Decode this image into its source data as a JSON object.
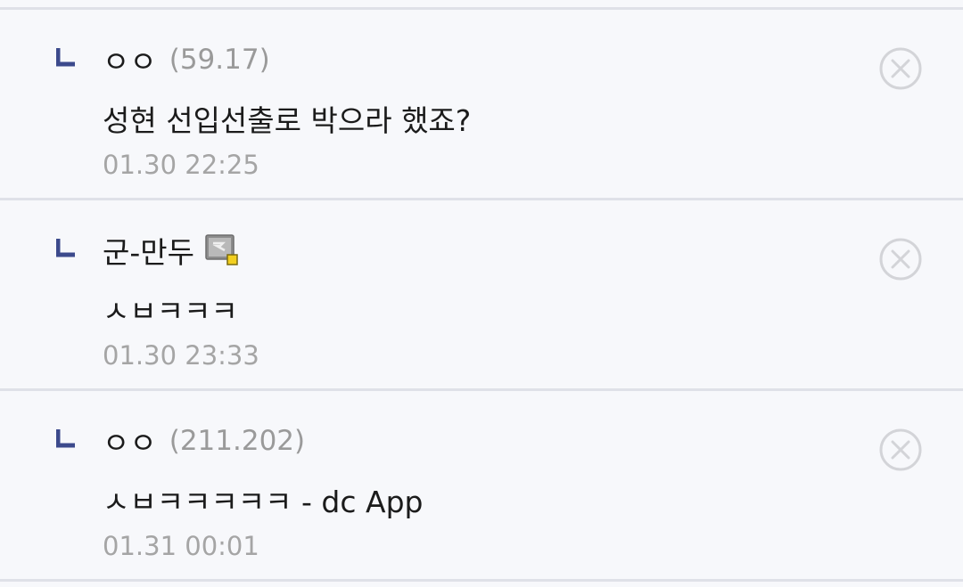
{
  "colors": {
    "background": "#f7f8fb",
    "divider": "#dfe1e8",
    "reply_mark": "#3c4a8c",
    "text": "#1b1b1b",
    "meta": "#a5a5a5",
    "delete_icon": "#d3d4d8"
  },
  "icons": {
    "reply": "reply-arrow-icon",
    "delete": "close-circle-icon",
    "badge": "fixed-nickname-badge-icon"
  },
  "comments": [
    {
      "nick": "ㅇㅇ",
      "ip": "(59.17)",
      "text": "성현 선입선출로 박으라 했죠?",
      "time": "01.30 22:25"
    },
    {
      "nick": "군-만두",
      "ip": "",
      "text": "ㅅㅂㅋㅋㅋ",
      "time": "01.30 23:33"
    },
    {
      "nick": "ㅇㅇ",
      "ip": "(211.202)",
      "text": "ㅅㅂㅋㅋㅋㅋㅋ - dc App",
      "time": "01.31 00:01"
    }
  ]
}
